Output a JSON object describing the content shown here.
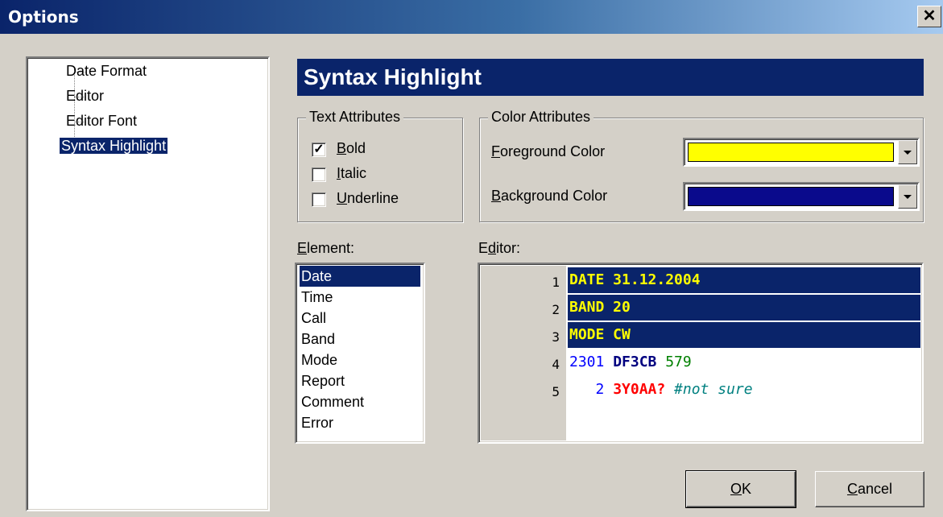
{
  "window": {
    "title": "Options",
    "close_glyph": "✕"
  },
  "tree": {
    "items": [
      {
        "label": "Date Format"
      },
      {
        "label": "Editor"
      },
      {
        "label": "Editor Font"
      },
      {
        "label": "Syntax Highlight",
        "selected": true
      }
    ]
  },
  "section_title": "Syntax Highlight",
  "text_attributes": {
    "label": "Text Attributes",
    "bold": {
      "label": "Bold",
      "mnemonic": "B",
      "rest": "old",
      "checked": true
    },
    "italic": {
      "label": "Italic",
      "mnemonic": "I",
      "rest": "talic",
      "checked": false
    },
    "underline": {
      "label": "Underline",
      "mnemonic": "U",
      "rest": "nderline",
      "checked": false
    }
  },
  "color_attributes": {
    "label": "Color Attributes",
    "foreground": {
      "label": "Foreground Color",
      "mnemonic": "F",
      "rest": "oreground Color",
      "color": "#ffff00"
    },
    "background": {
      "label": "Background Color",
      "mnemonic": "B",
      "rest": "ackground Color",
      "color": "#0a0a8c"
    }
  },
  "element_list": {
    "label": "Element:",
    "mnemonic": "E",
    "rest": "lement:",
    "items": [
      "Date",
      "Time",
      "Call",
      "Band",
      "Mode",
      "Report",
      "Comment",
      "Error"
    ],
    "selected": "Date"
  },
  "editor": {
    "label": "Editor:",
    "mnemonic_pre": "E",
    "mnemonic": "d",
    "rest": "itor:",
    "lines": [
      {
        "num": "1",
        "highlighted": true,
        "tokens": [
          {
            "text": "DATE 31.12.2004",
            "color": "#ffff00",
            "bold": true
          }
        ]
      },
      {
        "num": "2",
        "highlighted": true,
        "tokens": [
          {
            "text": "BAND 20",
            "color": "#ffff00",
            "bold": true
          }
        ]
      },
      {
        "num": "3",
        "highlighted": true,
        "tokens": [
          {
            "text": "MODE CW",
            "color": "#ffff00",
            "bold": true
          }
        ]
      },
      {
        "num": "4",
        "highlighted": false,
        "tokens": [
          {
            "text": "2301 ",
            "color": "#0000ff",
            "bold": false
          },
          {
            "text": "DF3CB ",
            "color": "#000080",
            "bold": true
          },
          {
            "text": "579",
            "color": "#008000",
            "bold": false
          }
        ]
      },
      {
        "num": "5",
        "highlighted": false,
        "tokens": [
          {
            "text": "   2 ",
            "color": "#0000ff",
            "bold": false
          },
          {
            "text": "3Y0AA? ",
            "color": "#ff0000",
            "bold": true
          },
          {
            "text": "#not sure",
            "color": "#008080",
            "bold": false,
            "italic": true
          }
        ]
      }
    ]
  },
  "buttons": {
    "ok": {
      "mnemonic": "O",
      "rest": "K"
    },
    "cancel": {
      "mnemonic": "C",
      "rest": "ancel"
    }
  }
}
